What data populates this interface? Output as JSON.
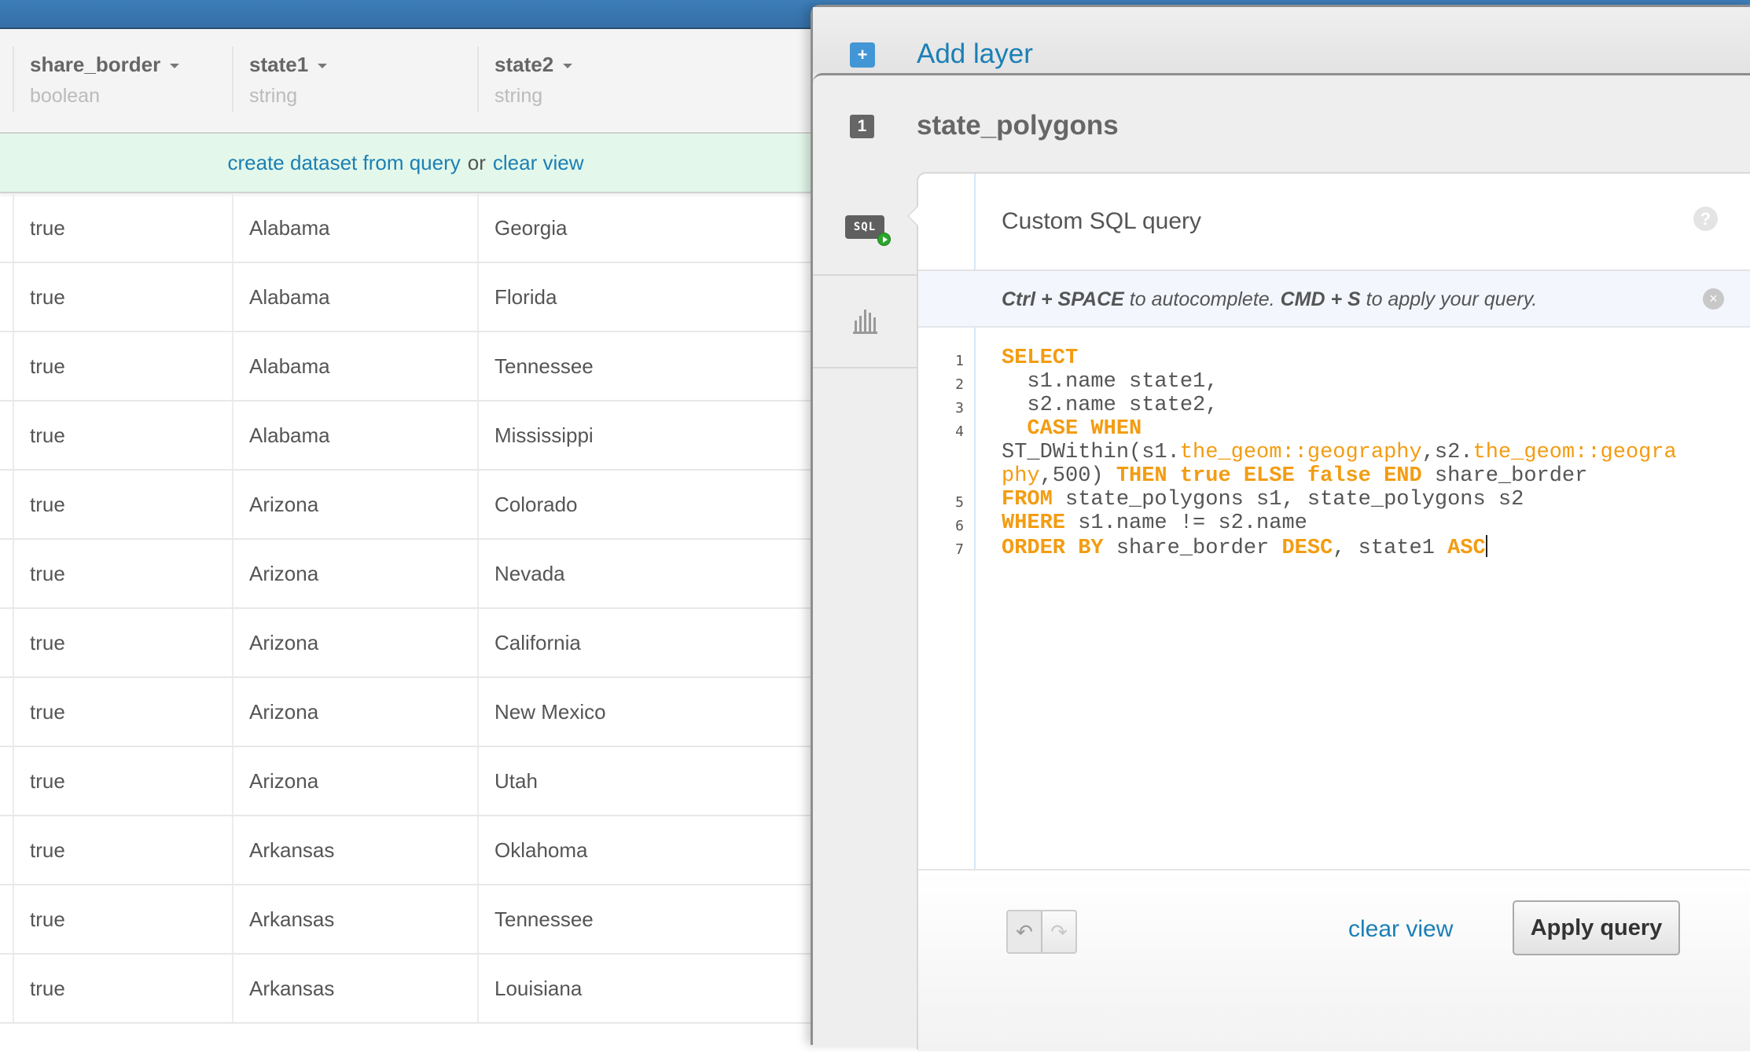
{
  "table": {
    "columns": [
      {
        "name": "share_border",
        "type": "boolean"
      },
      {
        "name": "state1",
        "type": "string"
      },
      {
        "name": "state2",
        "type": "string"
      }
    ],
    "banner": {
      "create_link": "create dataset from query",
      "separator": "or",
      "clear_link": "clear view"
    },
    "rows": [
      [
        "true",
        "Alabama",
        "Georgia"
      ],
      [
        "true",
        "Alabama",
        "Florida"
      ],
      [
        "true",
        "Alabama",
        "Tennessee"
      ],
      [
        "true",
        "Alabama",
        "Mississippi"
      ],
      [
        "true",
        "Arizona",
        "Colorado"
      ],
      [
        "true",
        "Arizona",
        "Nevada"
      ],
      [
        "true",
        "Arizona",
        "California"
      ],
      [
        "true",
        "Arizona",
        "New Mexico"
      ],
      [
        "true",
        "Arizona",
        "Utah"
      ],
      [
        "true",
        "Arkansas",
        "Oklahoma"
      ],
      [
        "true",
        "Arkansas",
        "Tennessee"
      ],
      [
        "true",
        "Arkansas",
        "Louisiana"
      ]
    ]
  },
  "panel": {
    "add_layer": {
      "icon": "plus-icon",
      "label": "Add layer"
    },
    "layer": {
      "number": "1",
      "name": "state_polygons"
    },
    "sidebar": [
      {
        "icon": "sql-icon",
        "label": "SQL"
      },
      {
        "icon": "bar-chart-icon"
      }
    ],
    "sql": {
      "title": "Custom SQL query",
      "help_icon": "?",
      "hint": {
        "k1": "Ctrl + SPACE",
        "t1": " to autocomplete. ",
        "k2": "CMD + S",
        "t2": " to apply your query."
      },
      "close_icon": "×",
      "lines": [
        {
          "n": "1",
          "segs": [
            [
              "kw",
              "SELECT"
            ]
          ]
        },
        {
          "n": "2",
          "segs": [
            [
              "tx",
              "  s1.name state1,"
            ]
          ]
        },
        {
          "n": "3",
          "segs": [
            [
              "tx",
              "  s2.name state2,"
            ]
          ]
        },
        {
          "n": "4",
          "segs": [
            [
              "tx",
              "  "
            ],
            [
              "kw",
              "CASE WHEN"
            ]
          ]
        },
        {
          "n": "",
          "segs": [
            [
              "tx",
              "ST_DWithin(s1."
            ],
            [
              "fn",
              "the_geom::geography"
            ],
            [
              "tx",
              ",s2."
            ],
            [
              "fn",
              "the_geom::geogra"
            ]
          ]
        },
        {
          "n": "",
          "segs": [
            [
              "fn",
              "phy"
            ],
            [
              "tx",
              ",500) "
            ],
            [
              "kw",
              "THEN true ELSE false END"
            ],
            [
              "tx",
              " share_border"
            ]
          ]
        },
        {
          "n": "5",
          "segs": [
            [
              "kw",
              "FROM"
            ],
            [
              "tx",
              " state_polygons s1, state_polygons s2"
            ]
          ]
        },
        {
          "n": "6",
          "segs": [
            [
              "kw",
              "WHERE"
            ],
            [
              "tx",
              " s1.name != s2.name"
            ]
          ]
        },
        {
          "n": "7",
          "segs": [
            [
              "kw",
              "ORDER BY"
            ],
            [
              "tx",
              " share_border "
            ],
            [
              "kw",
              "DESC"
            ],
            [
              "tx",
              ", state1 "
            ],
            [
              "kw",
              "ASC"
            ]
          ]
        }
      ],
      "undo_icon": "↶",
      "redo_icon": "↷",
      "clear_view": "clear view",
      "apply": "Apply query"
    }
  },
  "colors": {
    "topbar": "#3d7db8",
    "link": "#1b7fb5",
    "keyword": "#f39c12",
    "banner_bg": "#e3f8ea",
    "hint_bg": "#f3f6fd"
  }
}
